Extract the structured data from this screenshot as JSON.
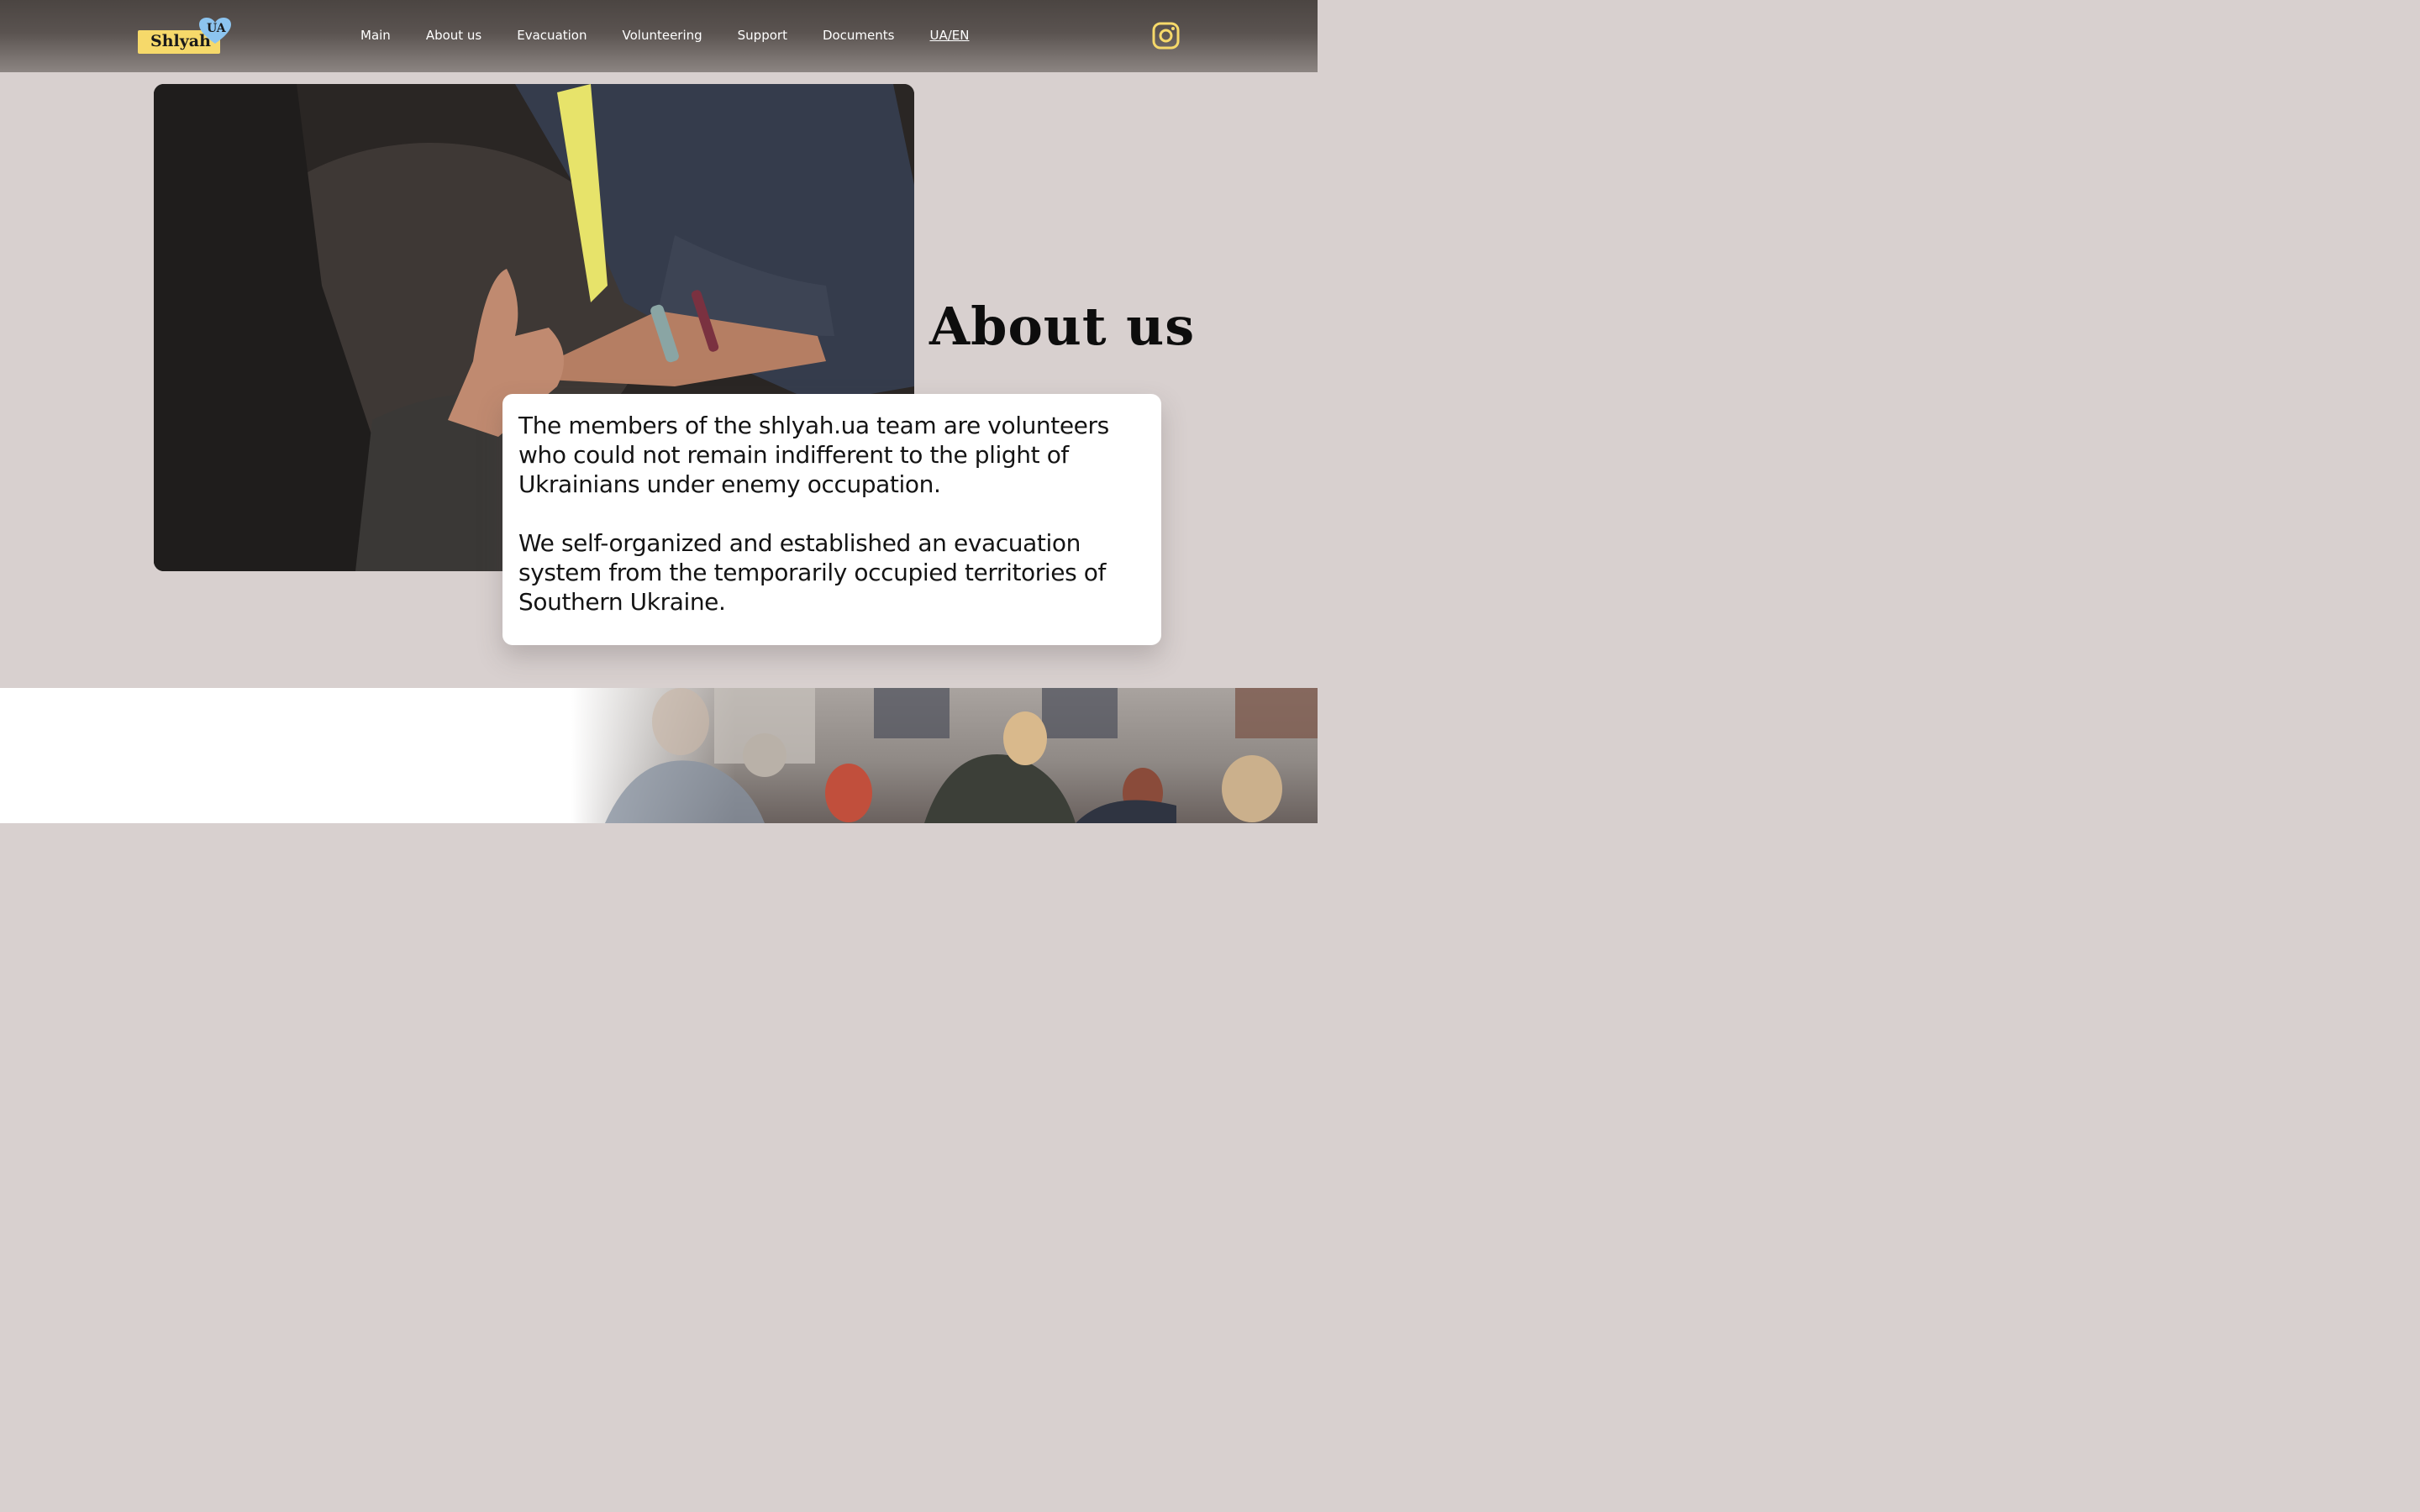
{
  "header": {
    "logo": {
      "word": "Shlyah",
      "badge": "UA"
    },
    "nav": [
      {
        "label": "Main"
      },
      {
        "label": "About us"
      },
      {
        "label": "Evacuation"
      },
      {
        "label": "Volunteering"
      },
      {
        "label": "Support"
      },
      {
        "label": "Documents"
      },
      {
        "label": "UA/EN"
      }
    ],
    "social_icon": "instagram-icon"
  },
  "colors": {
    "accent_yellow": "#f6d96a",
    "accent_blue": "#8cc4ef",
    "page_bg": "#d8d0cf"
  },
  "hero": {
    "title": "About us",
    "paragraphs": [
      "The members of the shlyah.ua team are volunteers who could not remain indifferent to the plight of Ukrainians under enemy occupation.",
      "We self-organized and established an evacuation system from the temporarily occupied territories of Southern Ukraine."
    ]
  }
}
